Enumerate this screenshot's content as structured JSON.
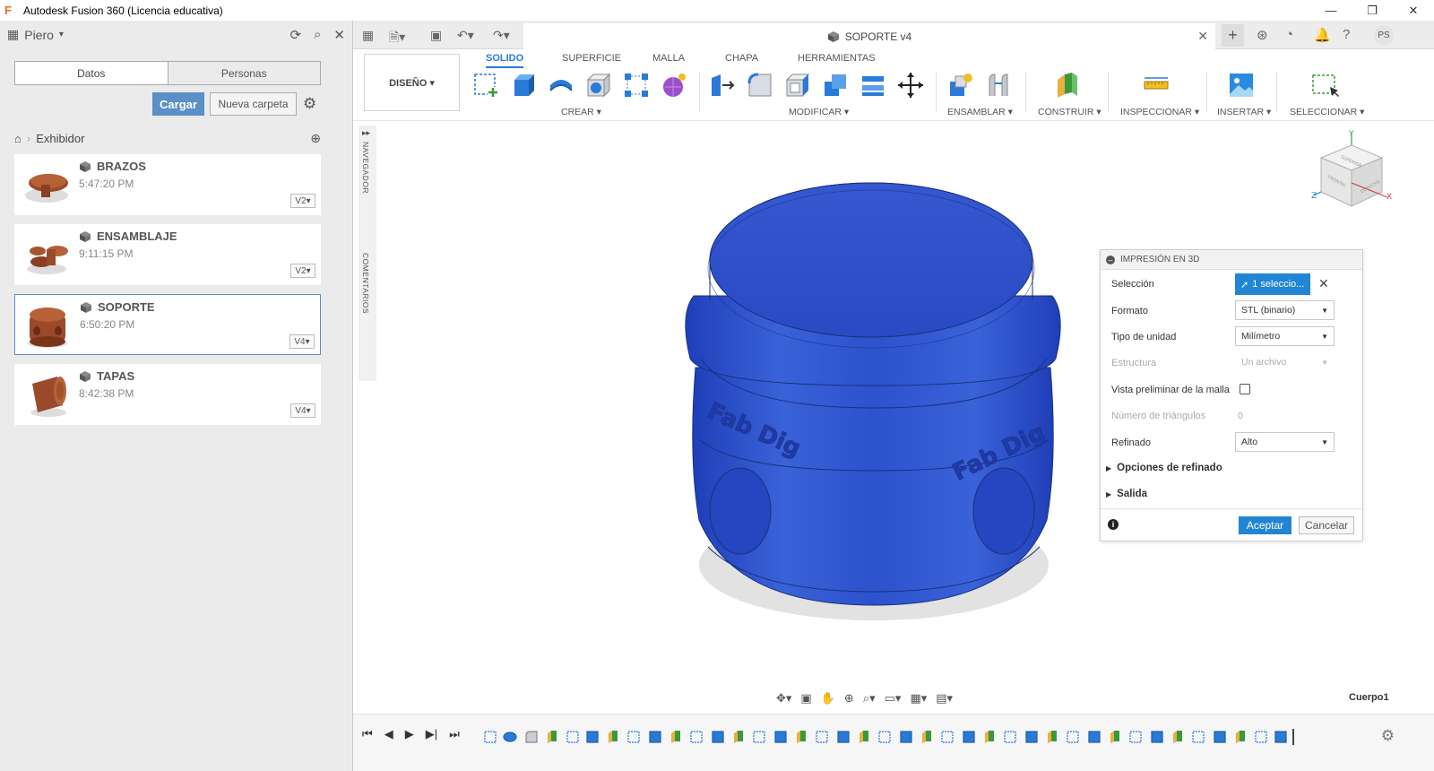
{
  "window": {
    "title": "Autodesk Fusion 360 (Licencia educativa)",
    "minimize": "—",
    "maximize": "❐",
    "close": "✕"
  },
  "data_panel": {
    "team_name": "Piero",
    "tabs": [
      "Datos",
      "Personas"
    ],
    "upload_label": "Cargar",
    "new_folder_label": "Nueva carpeta",
    "breadcrumb_folder": "Exhibidor",
    "files": [
      {
        "name": "BRAZOS",
        "time": "5:47:20 PM",
        "version": "V2"
      },
      {
        "name": "ENSAMBLAJE",
        "time": "9:11:15 PM",
        "version": "V2"
      },
      {
        "name": "SOPORTE",
        "time": "6:50:20 PM",
        "version": "V4"
      },
      {
        "name": "TAPAS",
        "time": "8:42:38 PM",
        "version": "V4"
      }
    ]
  },
  "document_tab": {
    "title": "SOPORTE v4",
    "avatar": "PS"
  },
  "toolbar": {
    "workspace_label": "DISEÑO ▾",
    "tabs": [
      "SOLIDO",
      "SUPERFICIE",
      "MALLA",
      "CHAPA",
      "HERRAMIENTAS"
    ],
    "groups": [
      "CREAR ▾",
      "MODIFICAR ▾",
      "ENSAMBLAR ▾",
      "CONSTRUIR ▾",
      "INSPECCIONAR ▾",
      "INSERTAR ▾",
      "SELECCIONAR ▾"
    ]
  },
  "side_strip": {
    "navigator": "NAVEGADOR",
    "comments": "COMENTARIOS"
  },
  "dialog": {
    "title": "IMPRESIÓN EN 3D",
    "selection_label": "Selección",
    "selection_value": "1 seleccio...",
    "format_label": "Formato",
    "format_value": "STL (binario)",
    "unit_label": "Tipo de unidad",
    "unit_value": "Milímetro",
    "structure_label": "Estructura",
    "structure_value": "Un archivo",
    "preview_label": "Vista preliminar de la malla",
    "triangles_label": "Número de triángulos",
    "triangles_value": "0",
    "refine_label": "Refinado",
    "refine_value": "Alto",
    "refine_options_label": "Opciones de refinado",
    "output_label": "Salida",
    "ok_label": "Aceptar",
    "cancel_label": "Cancelar"
  },
  "model": {
    "engraving": "Fab Dig",
    "color": "#2e52c9"
  },
  "viewcube": {
    "axis_y": "Y",
    "axis_x": "X",
    "axis_z": "Z",
    "top": "SUPERIOR",
    "front": "FRONTAL",
    "right": "DERECHA"
  },
  "status": {
    "body_label": "Cuerpo1"
  },
  "colors": {
    "accent": "#2285d4",
    "upload": "#5a8fc7"
  }
}
